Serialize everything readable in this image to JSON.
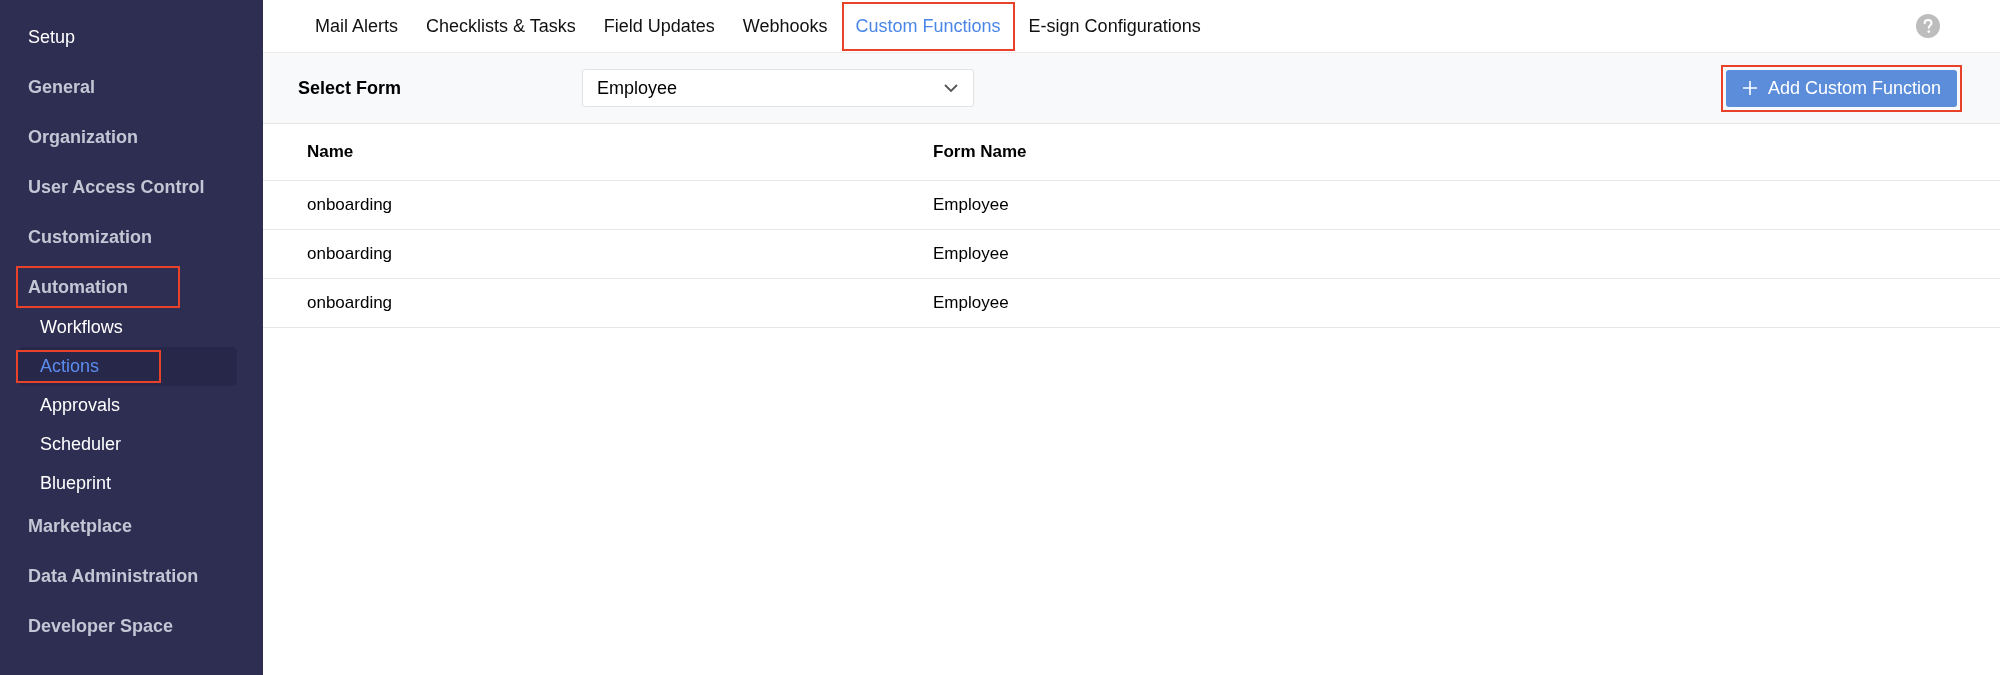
{
  "sidebar": {
    "title": "Setup",
    "items": [
      {
        "label": "General",
        "highlighted": false
      },
      {
        "label": "Organization",
        "highlighted": false
      },
      {
        "label": "User Access Control",
        "highlighted": false
      },
      {
        "label": "Customization",
        "highlighted": false
      },
      {
        "label": "Automation",
        "highlighted": true,
        "children": [
          {
            "label": "Workflows",
            "selected": false,
            "highlighted": false
          },
          {
            "label": "Actions",
            "selected": true,
            "highlighted": true
          },
          {
            "label": "Approvals",
            "selected": false,
            "highlighted": false
          },
          {
            "label": "Scheduler",
            "selected": false,
            "highlighted": false
          },
          {
            "label": "Blueprint",
            "selected": false,
            "highlighted": false
          }
        ]
      },
      {
        "label": "Marketplace",
        "highlighted": false
      },
      {
        "label": "Data Administration",
        "highlighted": false
      },
      {
        "label": "Developer Space",
        "highlighted": false
      }
    ]
  },
  "tabs": [
    {
      "label": "Mail Alerts",
      "selected": false,
      "highlighted": false
    },
    {
      "label": "Checklists & Tasks",
      "selected": false,
      "highlighted": false
    },
    {
      "label": "Field Updates",
      "selected": false,
      "highlighted": false
    },
    {
      "label": "Webhooks",
      "selected": false,
      "highlighted": false
    },
    {
      "label": "Custom Functions",
      "selected": true,
      "highlighted": true
    },
    {
      "label": "E-sign Configurations",
      "selected": false,
      "highlighted": false
    }
  ],
  "form_bar": {
    "label": "Select Form",
    "dropdown_value": "Employee",
    "button": {
      "label": "Add Custom Function",
      "highlighted": true
    }
  },
  "table": {
    "columns": [
      "Name",
      "Form Name"
    ],
    "rows": [
      [
        "onboarding",
        "Employee"
      ],
      [
        "onboarding",
        "Employee"
      ],
      [
        "onboarding",
        "Employee"
      ]
    ]
  }
}
